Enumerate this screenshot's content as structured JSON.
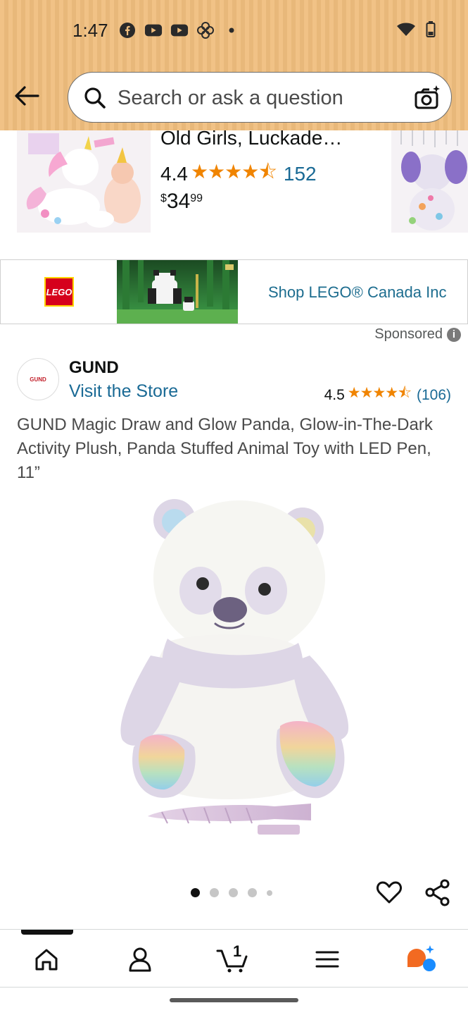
{
  "status_bar": {
    "time": "1:47"
  },
  "search": {
    "placeholder": "Search or ask a question"
  },
  "carousel_item": {
    "title": "Old Girls, Luckade…",
    "rating": "4.4",
    "stars": "★★★★⯪",
    "review_count": "152",
    "price_currency": "$",
    "price_whole": "34",
    "price_fraction": "99"
  },
  "sponsored_ad": {
    "brand_logo_text": "LEGO",
    "link_text": "Shop LEGO® Canada Inc",
    "sponsored_label": "Sponsored"
  },
  "product": {
    "brand_name": "GUND",
    "brand_logo_text": "GUND",
    "visit_store": "Visit the Store",
    "rating": "4.5",
    "stars": "★★★★⯪",
    "review_count": "(106)",
    "title": "GUND Magic Draw and Glow Panda, Glow-in-The-Dark Activity Plush, Panda Stuffed Animal Toy with LED Pen, 11”",
    "image_count": 5,
    "current_image": 1
  },
  "bottom_nav": {
    "items": [
      "home",
      "account",
      "cart",
      "menu",
      "rufus"
    ],
    "cart_count": "1",
    "active": "home"
  },
  "colors": {
    "header_bg": "#f0be7e",
    "link": "#1a6a95",
    "star": "#f08400",
    "lego_red": "#d6001c"
  }
}
